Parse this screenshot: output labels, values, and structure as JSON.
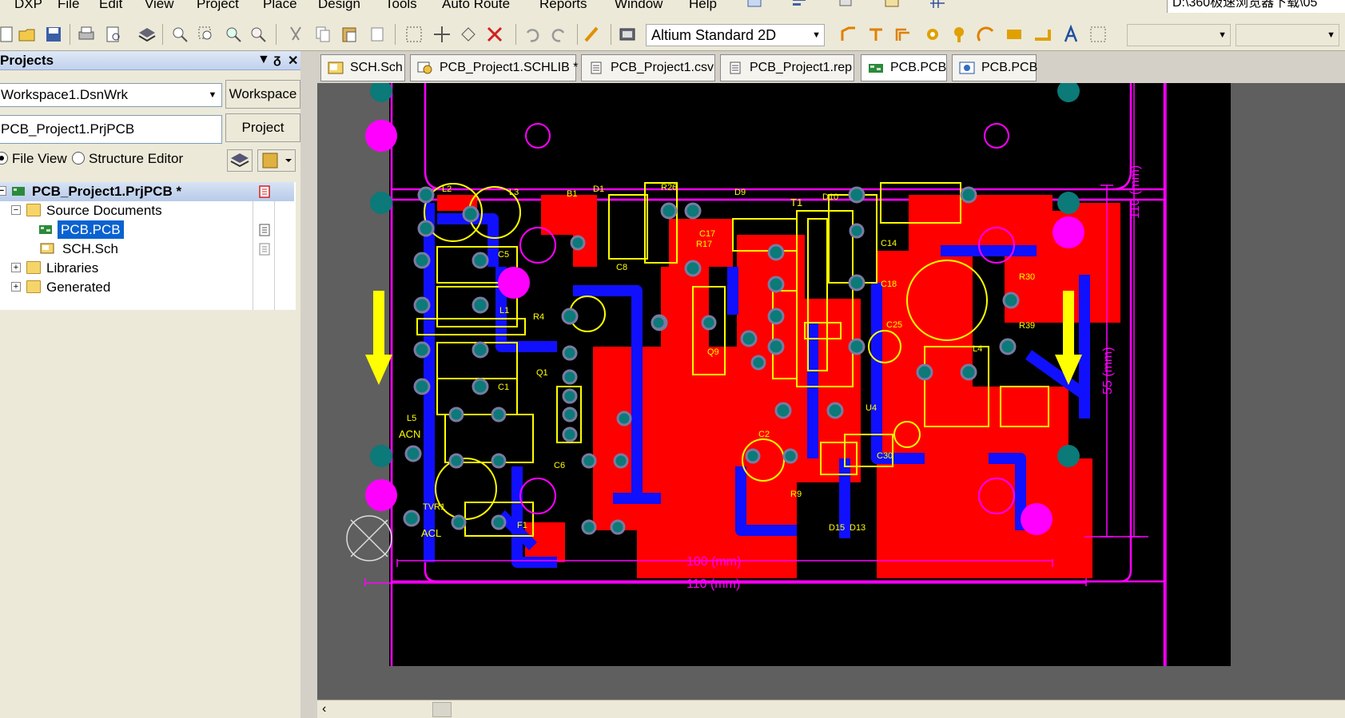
{
  "menu": {
    "items": [
      "DXP",
      "File",
      "Edit",
      "View",
      "Project",
      "Place",
      "Design",
      "Tools",
      "Auto Route",
      "Reports",
      "Window",
      "Help"
    ],
    "path_text": "D:\\360极速浏览器下载\\05"
  },
  "toolbar": {
    "view_mode": "Altium Standard 2D"
  },
  "panel": {
    "title": "Projects",
    "workspace_value": "Workspace1.DsnWrk",
    "workspace_button": "Workspace",
    "project_value": "PCB_Project1.PrjPCB",
    "project_button": "Project",
    "file_view_label": "File View",
    "structure_editor_label": "Structure Editor",
    "tree": {
      "root": "PCB_Project1.PrjPCB *",
      "source_documents": "Source Documents",
      "pcb_doc": "PCB.PCB",
      "sch_doc": "SCH.Sch",
      "libraries": "Libraries",
      "generated": "Generated"
    }
  },
  "tabs": [
    {
      "label": "SCH.Sch",
      "icon": "schematic-icon"
    },
    {
      "label": "PCB_Project1.SCHLIB *",
      "icon": "schlib-icon"
    },
    {
      "label": "PCB_Project1.csv",
      "icon": "document-icon"
    },
    {
      "label": "PCB_Project1.rep",
      "icon": "document-icon"
    },
    {
      "label": "PCB.PCB",
      "icon": "pcb-icon"
    },
    {
      "label": "PCB.PCB",
      "icon": "pcb3d-icon"
    }
  ],
  "pcb": {
    "dim_width_inner": "100 (mm)",
    "dim_width_outer": "110 (mm)",
    "dim_height_inner": "55 (mm)",
    "dim_height_outer": "110 (mm)",
    "labels": {
      "l2": "L2",
      "l3": "L3",
      "b1": "B1",
      "d1": "D1",
      "r26": "R26",
      "d9": "D9",
      "t1": "T1",
      "d10": "D10",
      "c5": "C5",
      "l1": "L1",
      "c17": "C17",
      "r17": "R17",
      "c14": "C14",
      "c18": "C18",
      "c8": "C8",
      "r4": "R4",
      "q1": "Q1",
      "c1": "C1",
      "l5": "L5",
      "acn": "ACN",
      "c6": "C6",
      "tvr1": "TVR1",
      "f1": "F1",
      "acl": "ACL",
      "r30": "R30",
      "r39": "R39",
      "l4": "L4",
      "c25": "C25",
      "c2": "C2",
      "c30": "C30",
      "u4": "U4",
      "d13": "D13",
      "d15": "D15",
      "r9": "R9",
      "q9": "Q9"
    }
  },
  "colors": {
    "board_bg": "#000000",
    "top_copper": "#ff0000",
    "bottom_copper": "#0000ff",
    "silkscreen": "#ffff00",
    "keepout": "#ff00ff",
    "pad": "#0b7a78",
    "workspace_gray": "#5f5f5f"
  }
}
